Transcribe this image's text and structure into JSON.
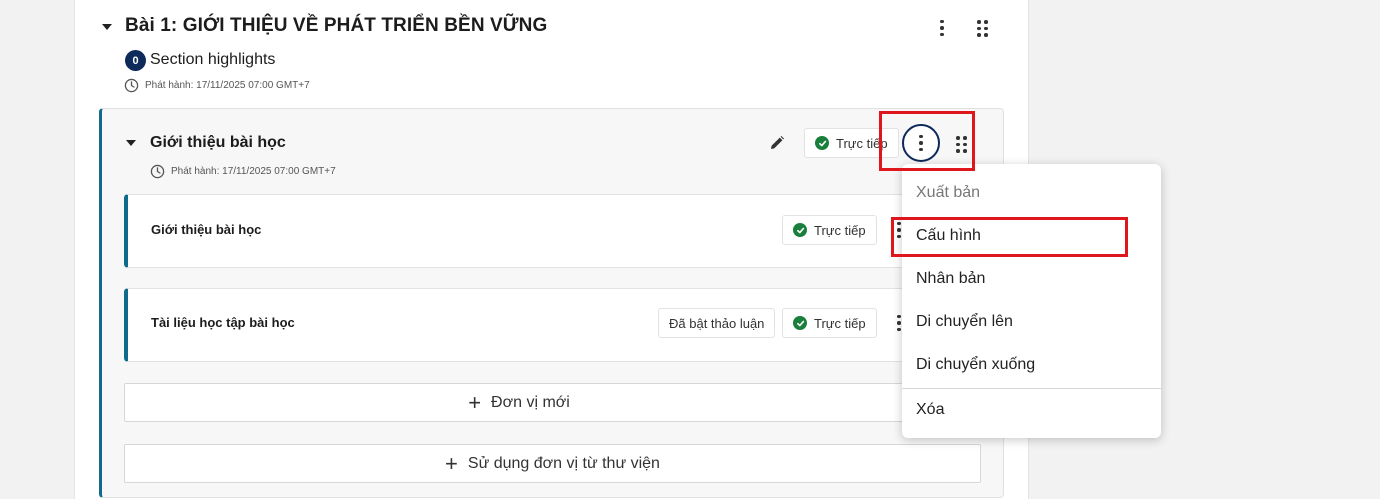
{
  "section": {
    "title": "Bài 1: GIỚI THIỆU VỀ PHÁT TRIỂN BỀN VỮNG",
    "highlights_count": "0",
    "highlights_label": "Section highlights",
    "release": "Phát hành: 17/11/2025 07:00 GMT+7"
  },
  "subsection": {
    "title": "Giới thiệu bài học",
    "release": "Phát hành: 17/11/2025 07:00 GMT+7",
    "status": "Trực tiếp"
  },
  "units": [
    {
      "title": "Giới thiệu bài học",
      "status": "Trực tiếp"
    },
    {
      "title": "Tài liệu học tập bài học",
      "discussion": "Đã bật thảo luận",
      "status": "Trực tiếp"
    }
  ],
  "buttons": {
    "new_unit": "Đơn vị mới",
    "library_unit": "Sử dụng đơn vị từ thư viện"
  },
  "menu": {
    "items": [
      {
        "label": "Xuất bản",
        "disabled": true
      },
      {
        "label": "Cấu hình"
      },
      {
        "label": "Nhân bản"
      },
      {
        "label": "Di chuyển lên"
      },
      {
        "label": "Di chuyển xuống"
      },
      {
        "label": "Xóa"
      }
    ]
  },
  "colors": {
    "accent": "#0f6a8b",
    "badge": "#0e2a5a",
    "status_green": "#1a7f3c",
    "highlight_red": "#e0161d"
  }
}
